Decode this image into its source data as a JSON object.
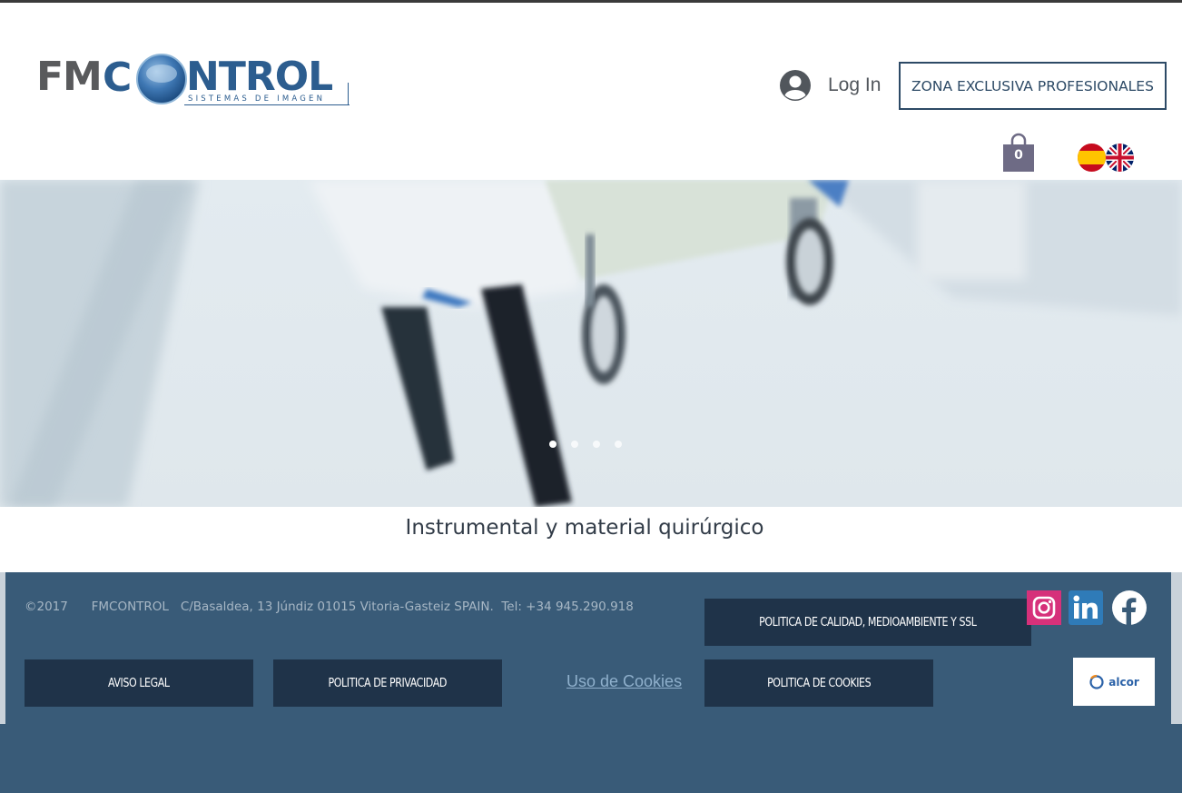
{
  "header": {
    "logo_text_left": "FMC",
    "logo_text_right": "NTROL",
    "logo_tagline": "SISTEMAS DE IMAGEN",
    "login_label": "Log In",
    "zona_button": "ZONA EXCLUSIVA PROFESIONALES",
    "cart_count": "0",
    "languages": [
      "es",
      "en"
    ]
  },
  "hero": {
    "slides_total": 4,
    "active_slide": 1,
    "caption": "Instrumental y material quirúrgico"
  },
  "footer": {
    "address": "©2017      FMCONTROL   C/Basaldea, 13 Júndiz 01015 Vitoria-Gasteiz SPAIN.  Tel: +34 945.290.918",
    "buttons": {
      "calidad": "POLITICA DE CALIDAD, MEDIOAMBIENTE Y SSL",
      "aviso_legal": "AVISO LEGAL",
      "privacidad": "POLITICA DE PRIVACIDAD",
      "politica_cookies": "POLITICA DE COOKIES"
    },
    "cookies_link": "Uso de Cookies",
    "social": [
      "instagram",
      "linkedin",
      "facebook"
    ],
    "partner_logo_text": "alcor"
  },
  "colors": {
    "brand_blue": "#2c5d8f",
    "logo_grey": "#595a5c",
    "footer_bg": "#395b78",
    "footer_button": "#1f3349"
  }
}
